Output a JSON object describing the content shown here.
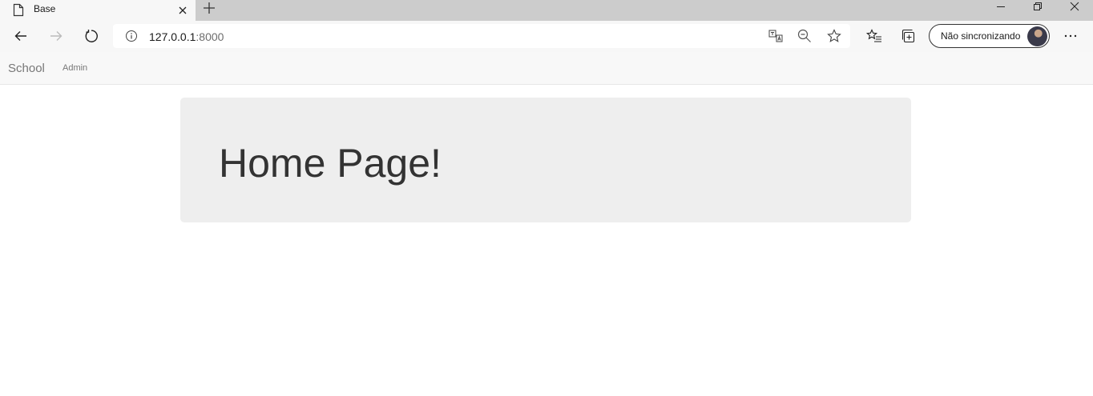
{
  "browser": {
    "tab": {
      "title": "Base"
    },
    "address_bar": {
      "host": "127.0.0.1",
      "port": ":8000"
    },
    "profile": {
      "label": "Não sincronizando"
    },
    "icons": {
      "page": "page-icon",
      "close_tab": "close-icon",
      "new_tab": "plus-icon",
      "minimize": "minimize-icon",
      "restore": "restore-icon",
      "close_window": "close-icon",
      "back": "arrow-left-icon",
      "forward": "arrow-right-icon",
      "refresh": "refresh-icon",
      "info": "info-icon",
      "translate": "translate-icon",
      "zoom": "zoom-out-icon",
      "favorite": "star-icon",
      "favorites": "favorites-icon",
      "collections": "collections-icon",
      "more": "more-icon"
    }
  },
  "navbar": {
    "brand": "School",
    "links": [
      {
        "label": "Admin"
      }
    ]
  },
  "main": {
    "heading": "Home Page!"
  },
  "colors": {
    "navbar_bg": "#f8f8f8",
    "jumbotron_bg": "#eeeeee",
    "heading_text": "#333333",
    "nav_text": "#777777"
  }
}
